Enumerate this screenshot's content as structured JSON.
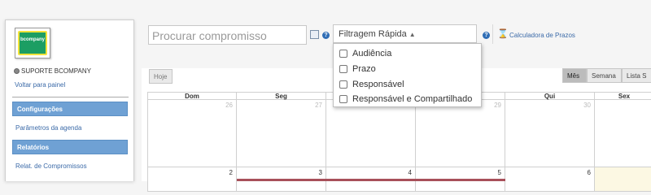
{
  "sidebar": {
    "logo_text": "bcompany",
    "user_name": "SUPORTE BCOMPANY",
    "back_link": "Voltar para painel",
    "config_section": "Configurações",
    "params_link": "Parâmetros da agenda",
    "reports_section": "Relatórios",
    "reports_link": "Relat. de Compromissos"
  },
  "toolbar": {
    "search_placeholder": "Procurar compromisso",
    "filter_label": "Filtragem Rápida",
    "calculator_link": "Calculadora de Prazos"
  },
  "filter_options": [
    {
      "label": "Audiência",
      "checked": false
    },
    {
      "label": "Prazo",
      "checked": false
    },
    {
      "label": "Responsável",
      "checked": false
    },
    {
      "label": "Responsável e Compartilhado",
      "checked": false
    }
  ],
  "calendar": {
    "today_button": "Hoje",
    "view_buttons": [
      "Mês",
      "Semana",
      "Lista S"
    ],
    "active_view": "Mês",
    "day_headers": [
      "Dom",
      "Seg",
      "",
      "",
      "Qui",
      "Sex"
    ],
    "row1_days": [
      "26",
      "27",
      "",
      "29",
      "30",
      ""
    ],
    "row2_days": [
      "2",
      "3",
      "4",
      "5",
      "6",
      ""
    ]
  },
  "colors": {
    "section_blue": "#6fa1d4",
    "link_blue": "#3b6aa8",
    "event_color": "#a8505a",
    "today_highlight": "#fcf8e3"
  }
}
